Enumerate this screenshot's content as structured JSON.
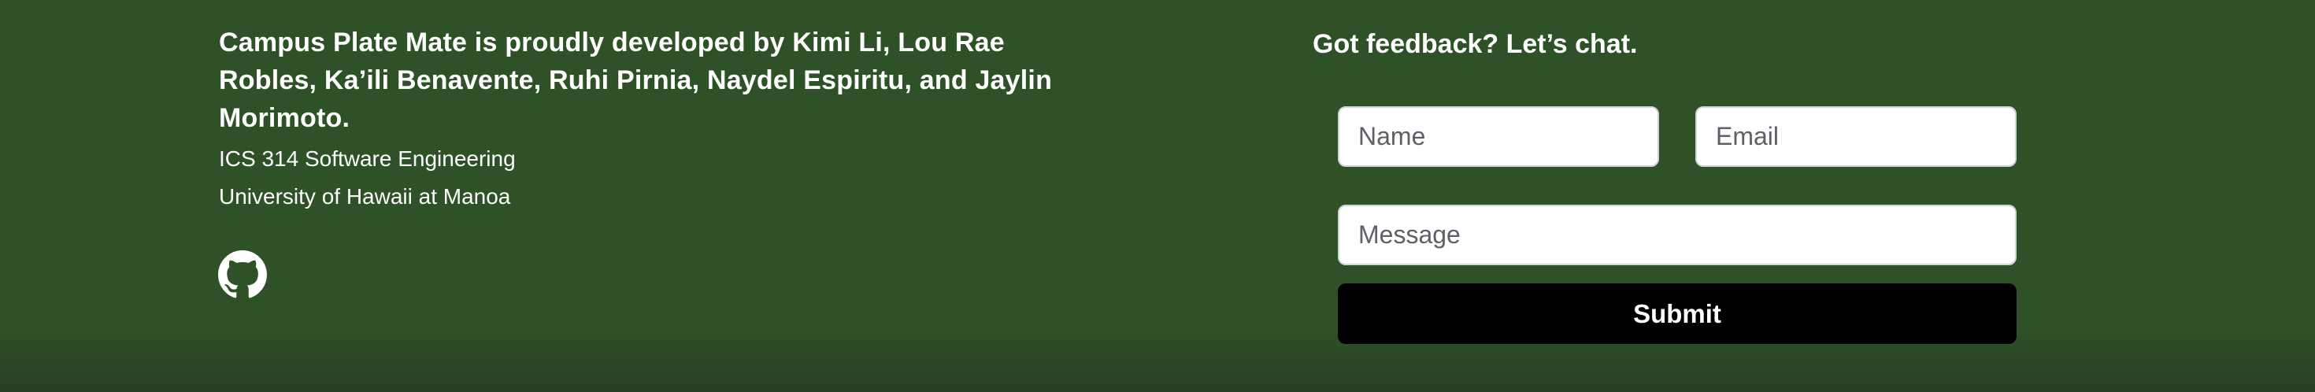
{
  "footer": {
    "credits": "Campus Plate Mate is proudly developed by Kimi Li, Lou Rae Robles, Ka’ili Benavente, Ruhi Pirnia, Naydel Espiritu, and Jaylin Morimoto.",
    "course_lines": [
      "ICS 314 Software Engineering",
      "University of Hawaii at Manoa"
    ],
    "github_icon": "github-icon",
    "feedback": {
      "title": "Got feedback? Let’s chat.",
      "name_placeholder": "Name",
      "email_placeholder": "Email",
      "message_placeholder": "Message",
      "submit_label": "Submit"
    }
  },
  "colors": {
    "background": "#2d5127",
    "text": "#ffffff",
    "submit_background": "#000000",
    "input_background": "#ffffff"
  }
}
